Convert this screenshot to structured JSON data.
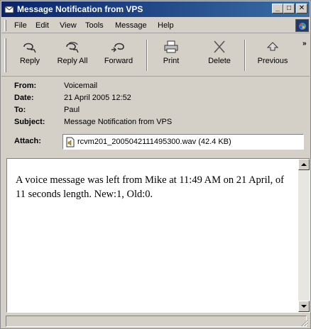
{
  "window": {
    "title": "Message Notification from VPS",
    "controls": {
      "minimize": "_",
      "maximize": "□",
      "close": "✕"
    }
  },
  "menu": {
    "items": [
      "File",
      "Edit",
      "View",
      "Tools",
      "Message",
      "Help"
    ]
  },
  "toolbar": {
    "buttons": [
      {
        "label": "Reply",
        "icon": "reply-icon"
      },
      {
        "label": "Reply All",
        "icon": "reply-all-icon"
      },
      {
        "label": "Forward",
        "icon": "forward-icon"
      },
      {
        "label": "Print",
        "icon": "print-icon"
      },
      {
        "label": "Delete",
        "icon": "delete-icon"
      },
      {
        "label": "Previous",
        "icon": "previous-icon"
      }
    ],
    "more": "»"
  },
  "header": {
    "from_label": "From:",
    "from_value": "Voicemail",
    "date_label": "Date:",
    "date_value": "21 April 2005 12:52",
    "to_label": "To:",
    "to_value": "Paul",
    "subject_label": "Subject:",
    "subject_value": "Message Notification from VPS",
    "attach_label": "Attach:",
    "attach_value": "rcvm201_2005042111495300.wav (42.4 KB)"
  },
  "body": {
    "text": "A voice message was left from Mike at 11:49 AM on 21 April, of 11 seconds length. New:1, Old:0."
  },
  "colors": {
    "titlebar_start": "#0a246a",
    "titlebar_end": "#3a6ea5",
    "chrome": "#d4d0c8"
  }
}
